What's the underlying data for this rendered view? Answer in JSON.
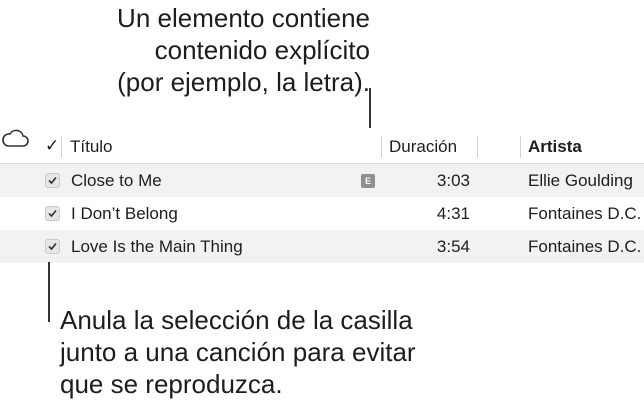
{
  "callouts": {
    "top": [
      "Un elemento contiene",
      "contenido explícito",
      "(por ejemplo, la letra)."
    ],
    "bottom": [
      "Anula la selección de la casilla",
      "junto a una canción para evitar",
      "que se reproduzca."
    ]
  },
  "table": {
    "columns": {
      "check": "✓",
      "title": "Título",
      "duration": "Duración",
      "cloud_icon": "cloud-icon",
      "artist": "Artista"
    },
    "rows": [
      {
        "checked": true,
        "title": "Close to Me",
        "explicit": true,
        "explicit_label": "E",
        "duration": "3:03",
        "artist": "Ellie Goulding"
      },
      {
        "checked": true,
        "title": "I Don’t Belong",
        "explicit": false,
        "duration": "4:31",
        "artist": "Fontaines D.C."
      },
      {
        "checked": true,
        "title": "Love Is the Main Thing",
        "explicit": false,
        "duration": "3:54",
        "artist": "Fontaines D.C."
      }
    ]
  }
}
